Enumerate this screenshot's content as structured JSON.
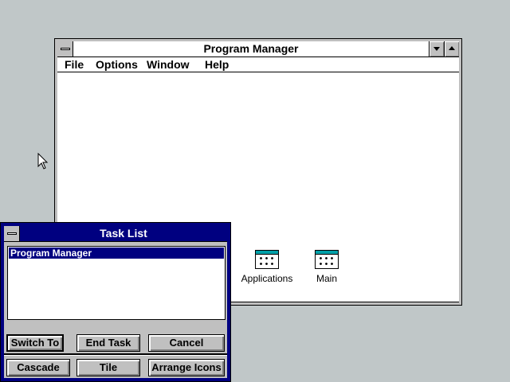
{
  "desktop": {
    "background": "#c0c7c8"
  },
  "program_manager": {
    "title": "Program Manager",
    "menu": [
      "File",
      "Options",
      "Window",
      "Help"
    ],
    "groups": [
      {
        "label": "Applications",
        "icon": "program-group-icon"
      },
      {
        "label": "Main",
        "icon": "program-group-icon"
      }
    ]
  },
  "task_list": {
    "title": "Task List",
    "items": [
      "Program Manager"
    ],
    "buttons": {
      "switch_to": "Switch To",
      "end_task": "End Task",
      "cancel": "Cancel",
      "cascade": "Cascade",
      "tile": "Tile",
      "arrange_icons": "Arrange Icons"
    },
    "title_color": "#000080"
  }
}
